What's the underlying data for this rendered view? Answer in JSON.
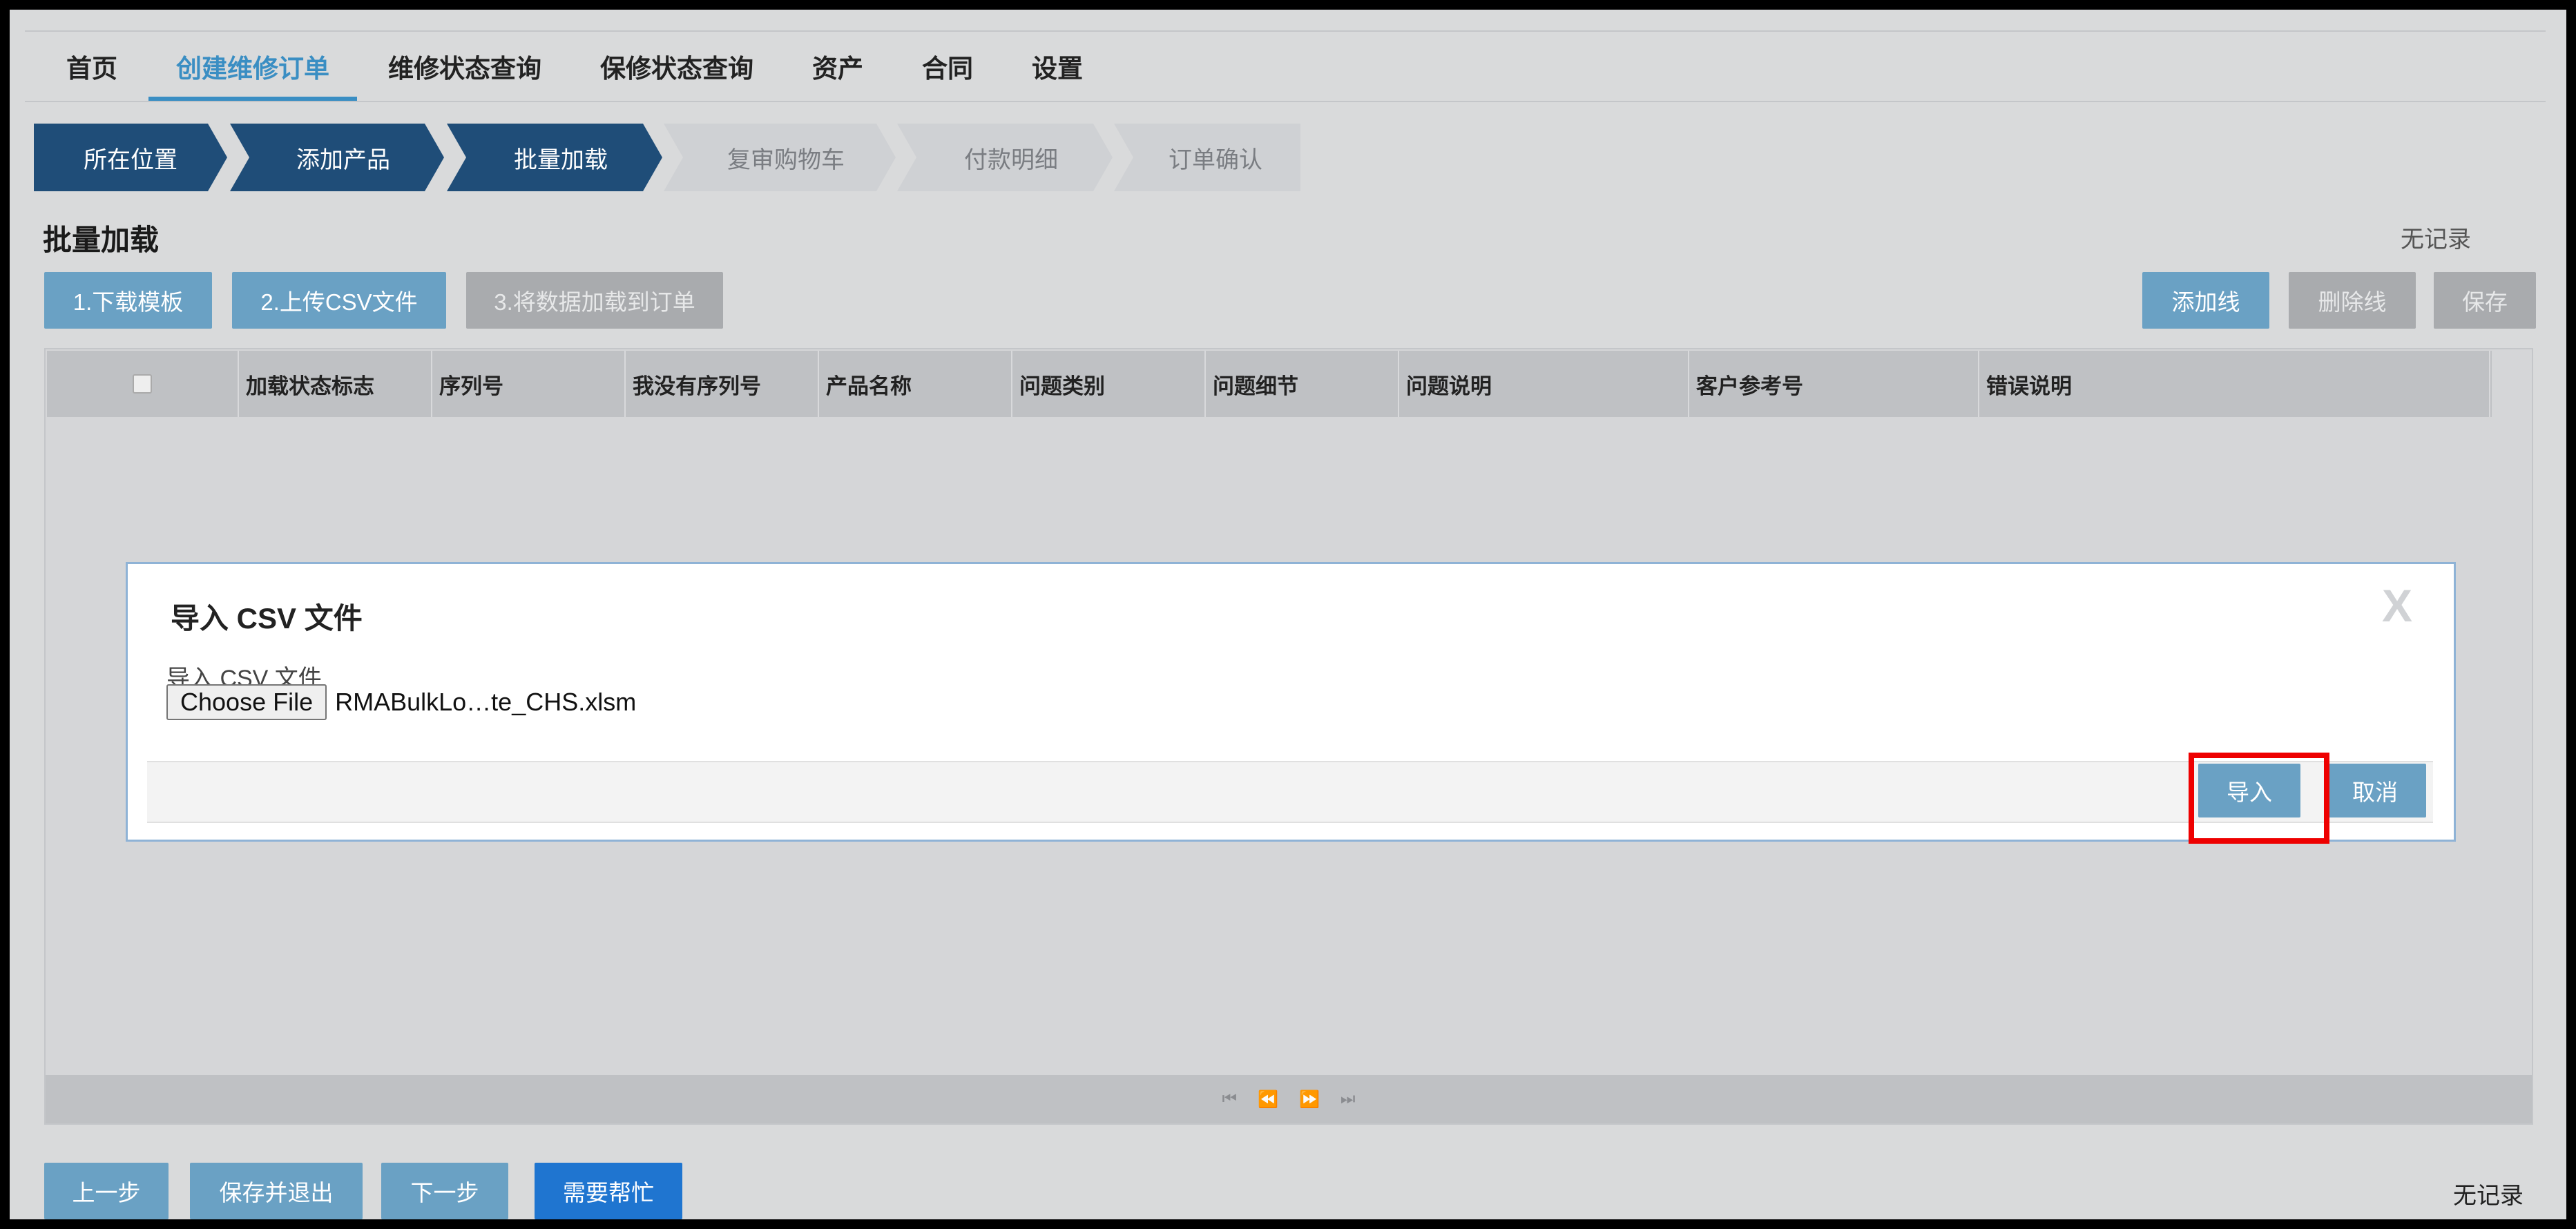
{
  "nav": {
    "items": [
      {
        "label": "首页"
      },
      {
        "label": "创建维修订单",
        "active": true
      },
      {
        "label": "维修状态查询"
      },
      {
        "label": "保修状态查询"
      },
      {
        "label": "资产"
      },
      {
        "label": "合同"
      },
      {
        "label": "设置"
      }
    ]
  },
  "steps": [
    {
      "label": "所在位置",
      "state": "done"
    },
    {
      "label": "添加产品",
      "state": "done"
    },
    {
      "label": "批量加载",
      "state": "done"
    },
    {
      "label": "复审购物车",
      "state": "todo"
    },
    {
      "label": "付款明细",
      "state": "todo"
    },
    {
      "label": "订单确认",
      "state": "todo"
    }
  ],
  "page": {
    "title": "批量加载",
    "no_record_top": "无记录",
    "no_record_bottom": "无记录"
  },
  "toolbar": {
    "download_template": "1.下载模板",
    "upload_csv": "2.上传CSV文件",
    "load_to_order": "3.将数据加载到订单",
    "add_line": "添加线",
    "delete_line": "删除线",
    "save": "保存"
  },
  "grid": {
    "columns": [
      "加载状态标志",
      "序列号",
      "我没有序列号",
      "产品名称",
      "问题类别",
      "问题细节",
      "问题说明",
      "客户参考号",
      "错误说明"
    ],
    "pager_icons": [
      "first-page-icon",
      "prev-page-icon",
      "next-page-icon",
      "last-page-icon"
    ]
  },
  "modal": {
    "title": "导入 CSV 文件",
    "close": "X",
    "field_label": "导入 CSV 文件",
    "file_button": "Choose File",
    "file_name": "RMABulkLo…te_CHS.xlsm",
    "import_button": "导入",
    "cancel_button": "取消"
  },
  "footer": {
    "prev": "上一步",
    "save_exit": "保存并退出",
    "next": "下一步",
    "help": "需要帮忙"
  },
  "colors": {
    "primary_dark": "#1f4d78",
    "accent": "#3a8ec3",
    "button_blue": "#6aa1c4",
    "help_blue": "#1f75d0",
    "highlight_red": "#ee0000"
  }
}
